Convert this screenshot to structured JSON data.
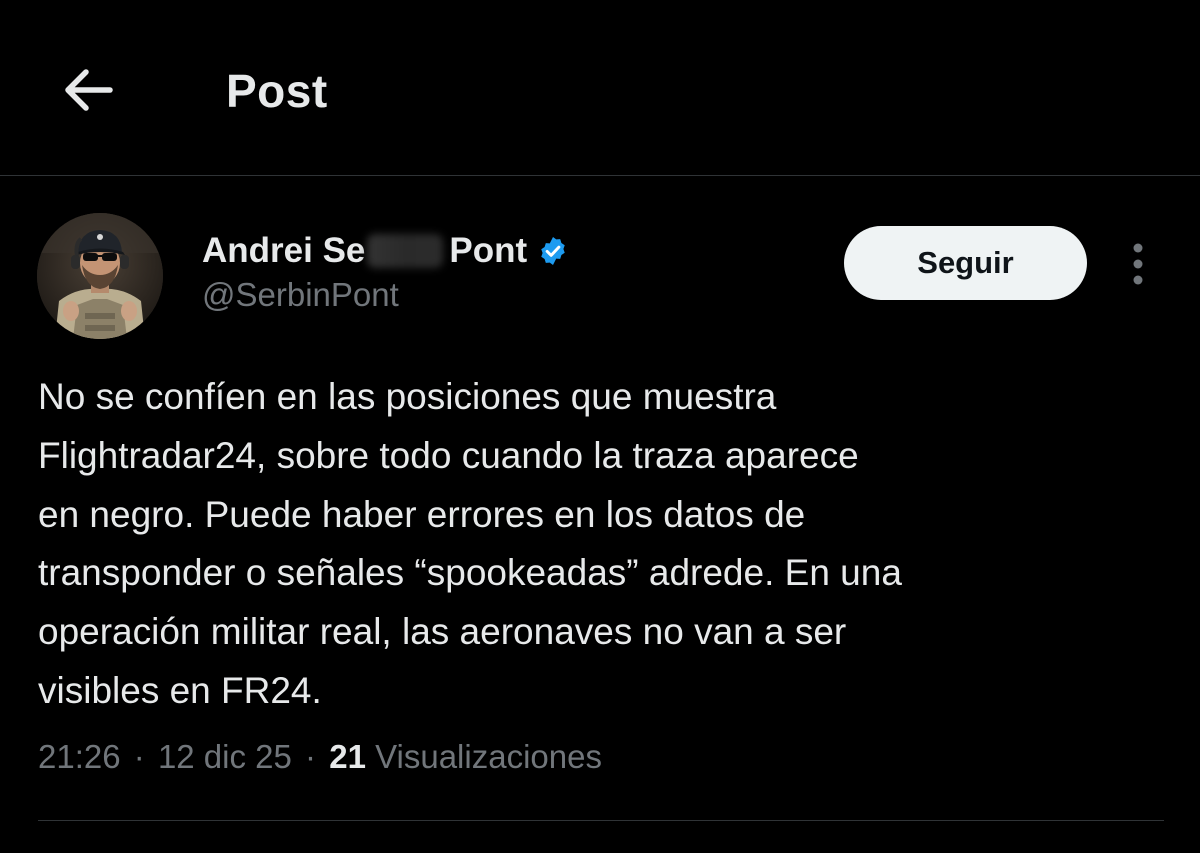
{
  "header": {
    "title": "Post"
  },
  "icons": {
    "back": "arrow-left-icon",
    "verified": "verified-badge-icon",
    "more": "more-vertical-icon"
  },
  "colors": {
    "background": "#000000",
    "text_primary": "#e7e9ea",
    "text_secondary": "#71767b",
    "verified_blue": "#1d9bf0",
    "follow_button_bg": "#eff3f4",
    "divider": "#2f3336"
  },
  "post": {
    "author": {
      "name_start": "Andrei Se",
      "name_end": "Pont",
      "handle": "@SerbinPont",
      "verified": true
    },
    "follow_label": "Seguir",
    "text_lines": [
      "No se confíen en las posiciones que muestra",
      "Flightradar24, sobre todo cuando la traza aparece",
      "en negro. Puede haber errores en los datos de",
      "transponder o señales “spookeadas” adrede. En una",
      "operación militar real, las aeronaves no van a ser",
      "visibles en FR24."
    ],
    "time": "21:26",
    "date": "12 dic 25",
    "separator": "·",
    "views_count": "21",
    "views_label": "Visualizaciones"
  }
}
